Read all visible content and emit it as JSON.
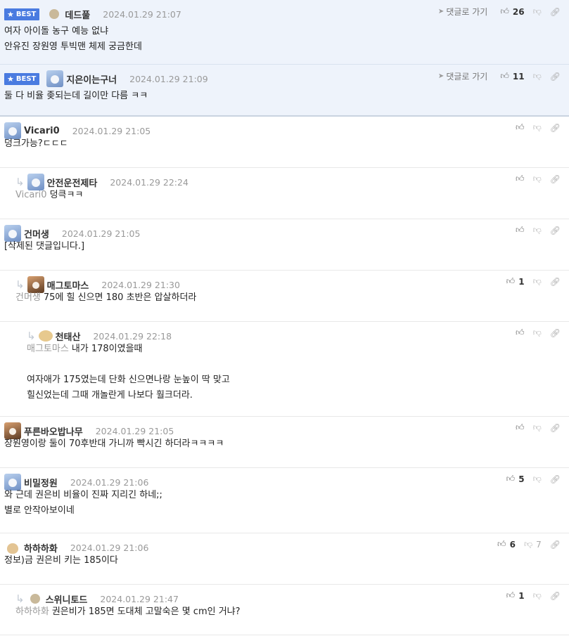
{
  "best_label": "BEST",
  "goto_label": "댓글로 가기",
  "comments": [
    {
      "best": true,
      "depth": 0,
      "avatar": "circle",
      "nick": "데드풀",
      "date": "2024.01.29 21:07",
      "lines": [
        "여자 아이돌 농구 예능 없냐",
        "안유진 장원영 투빅맨 체제 궁금한데"
      ],
      "up": "26",
      "down": ""
    },
    {
      "best": true,
      "depth": 0,
      "avatar": "bear",
      "nick": "지은이는구너",
      "date": "2024.01.29 21:09",
      "lines": [
        "둘 다 비율 좆되는데 길이만 다름 ㅋㅋ"
      ],
      "up": "11",
      "down": ""
    },
    {
      "best": false,
      "depth": 0,
      "avatar": "bear",
      "nick": "Vicari0",
      "date": "2024.01.29 21:05",
      "lines": [
        "덩크가능?ㄷㄷㄷ"
      ],
      "up": "",
      "down": ""
    },
    {
      "best": false,
      "depth": 1,
      "avatar": "bear",
      "nick": "안전운전제타",
      "date": "2024.01.29 22:24",
      "ref": "Vicari0",
      "lines": [
        "덩큭ㅋㅋ"
      ],
      "up": "",
      "down": ""
    },
    {
      "best": false,
      "depth": 0,
      "avatar": "bear",
      "nick": "건머생",
      "date": "2024.01.29 21:05",
      "lines": [
        "[삭제된 댓글입니다.]"
      ],
      "up": "",
      "down": ""
    },
    {
      "best": false,
      "depth": 1,
      "avatar": "dog",
      "nick": "매그토마스",
      "date": "2024.01.29 21:30",
      "ref": "건머생",
      "lines": [
        "75에 힐 신으면 180 초반은 압살하더라"
      ],
      "up": "1",
      "down": ""
    },
    {
      "best": false,
      "depth": 2,
      "avatar": "puppy",
      "nick": "천태산",
      "date": "2024.01.29 22:18",
      "ref": "매그토마스",
      "lines": [
        "내가 178이였을때",
        "",
        "여자애가 175였는데 단화 신으면나랑 눈높이 딱 맞고",
        "힐신었는데 그때 개놀란게 나보다 훨크더라."
      ],
      "up": "",
      "down": ""
    },
    {
      "best": false,
      "depth": 0,
      "avatar": "dog",
      "nick": "푸른바오밥나무",
      "date": "2024.01.29 21:05",
      "lines": [
        "장원영이랑 둘이 70후반대 가니까 빡시긴 하더라ㅋㅋㅋㅋ"
      ],
      "up": "",
      "down": ""
    },
    {
      "best": false,
      "depth": 0,
      "avatar": "bear",
      "nick": "비밀정원",
      "date": "2024.01.29 21:06",
      "lines": [
        "와 근데 권은비 비율이 진짜 지리긴 하네;;",
        "별로 안작아보이네"
      ],
      "up": "5",
      "down": ""
    },
    {
      "best": false,
      "depth": 0,
      "avatar": "fox",
      "nick": "하하하화",
      "date": "2024.01.29 21:06",
      "lines": [
        "정보)금 권은비 키는 185이다"
      ],
      "up": "6",
      "down": "7"
    },
    {
      "best": false,
      "depth": 1,
      "avatar": "circle",
      "nick": "스위니토드",
      "date": "2024.01.29 21:47",
      "ref": "하하하화",
      "lines": [
        "권은비가 185면 도대체 고말숙은 몇 cm인 거냐?"
      ],
      "up": "1",
      "down": ""
    }
  ]
}
